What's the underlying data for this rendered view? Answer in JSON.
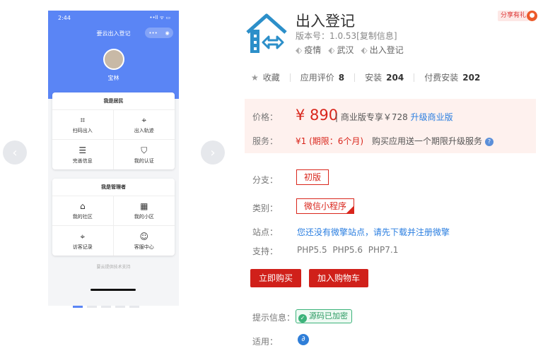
{
  "phone": {
    "time": "2:44",
    "status": "••ll ᯤ ▭",
    "title": "要云出入登记",
    "capsule": [
      "•••",
      "◉"
    ],
    "user_name": "宝林",
    "resident_card": {
      "title": "我是居民",
      "items": [
        {
          "label": "扫码出入",
          "icon": "scan-icon"
        },
        {
          "label": "出入轨迹",
          "icon": "location-icon"
        },
        {
          "label": "完善信息",
          "icon": "document-icon"
        },
        {
          "label": "我的认证",
          "icon": "shield-icon"
        }
      ]
    },
    "manager_card": {
      "title": "我是管理者",
      "items": [
        {
          "label": "我的社区",
          "icon": "house-icon"
        },
        {
          "label": "我的小区",
          "icon": "building-icon"
        },
        {
          "label": "访客记录",
          "icon": "location-icon"
        },
        {
          "label": "客服中心",
          "icon": "service-icon"
        }
      ]
    },
    "footer": "要云提供技术支持"
  },
  "app": {
    "name": "出入登记",
    "version": "版本号：1.0.53[复制信息]",
    "tags": [
      "疫情",
      "武汉",
      "出入登记"
    ],
    "share": "分享有礼",
    "stats": {
      "collect": "收藏",
      "rating_label": "应用评价",
      "rating": "8",
      "install_label": "安装",
      "install": "204",
      "paid_label": "付费安装",
      "paid": "202"
    },
    "price_label": "价格：",
    "price": "¥ 890",
    "price_rest_a": "| 商业版专享￥728 ",
    "price_rest_b": "升级商业版",
    "service_label": "服务：",
    "service": "¥1 (期限：6个月)",
    "service_note": "购买应用送一个期限升级服务",
    "branch_label": "分支：",
    "branch": "初版",
    "category_label": "类别：",
    "category": "微信小程序",
    "site_label": "站点：",
    "site_text": "您还没有微擎站点，请先下载并注册微擎",
    "support_label": "支持：",
    "support": "PHP5.5 PHP5.6 PHP7.1",
    "buy_button": "立即购买",
    "cart_button": "加入购物车",
    "hint_label": "提示信息：",
    "hint_badge": "源码已加密",
    "apply_label": "适用："
  },
  "colors": {
    "accent": "#d0201a",
    "phone_blue": "#5a85f5",
    "link": "#2a7ee0",
    "green": "#3cb37a"
  }
}
